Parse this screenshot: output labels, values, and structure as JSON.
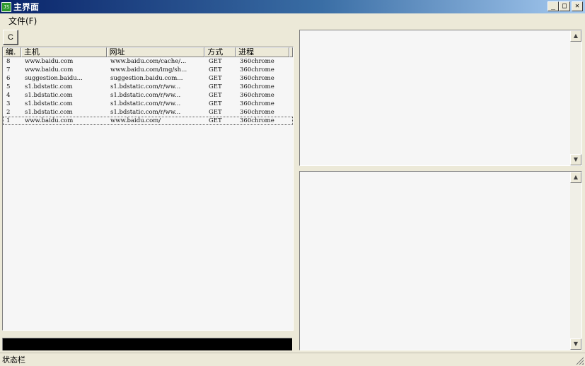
{
  "window": {
    "title": "主界面",
    "icon_label": "JS",
    "minimize_glyph": "_",
    "maximize_glyph": "□",
    "close_glyph": "✕"
  },
  "menubar": {
    "file_label": "文件(F)"
  },
  "toolbar": {
    "c_button_label": "C"
  },
  "table": {
    "columns": [
      "编.",
      "主机",
      "网址",
      "方式",
      "进程"
    ],
    "rows": [
      [
        "8",
        "www.baidu.com",
        "www.baidu.com/cache/...",
        "GET",
        "360chrome"
      ],
      [
        "7",
        "www.baidu.com",
        "www.baidu.com/img/sh...",
        "GET",
        "360chrome"
      ],
      [
        "6",
        "suggestion.baidu...",
        "suggestion.baidu.com...",
        "GET",
        "360chrome"
      ],
      [
        "5",
        "s1.bdstatic.com",
        "s1.bdstatic.com/r/ww...",
        "GET",
        "360chrome"
      ],
      [
        "4",
        "s1.bdstatic.com",
        "s1.bdstatic.com/r/ww...",
        "GET",
        "360chrome"
      ],
      [
        "3",
        "s1.bdstatic.com",
        "s1.bdstatic.com/r/ww...",
        "GET",
        "360chrome"
      ],
      [
        "2",
        "s1.bdstatic.com",
        "s1.bdstatic.com/r/ww...",
        "GET",
        "360chrome"
      ],
      [
        "1",
        "www.baidu.com",
        "www.baidu.com/",
        "GET",
        "360chrome"
      ]
    ]
  },
  "scroll": {
    "up_glyph": "▲",
    "down_glyph": "▼"
  },
  "statusbar": {
    "text": "状态栏"
  }
}
